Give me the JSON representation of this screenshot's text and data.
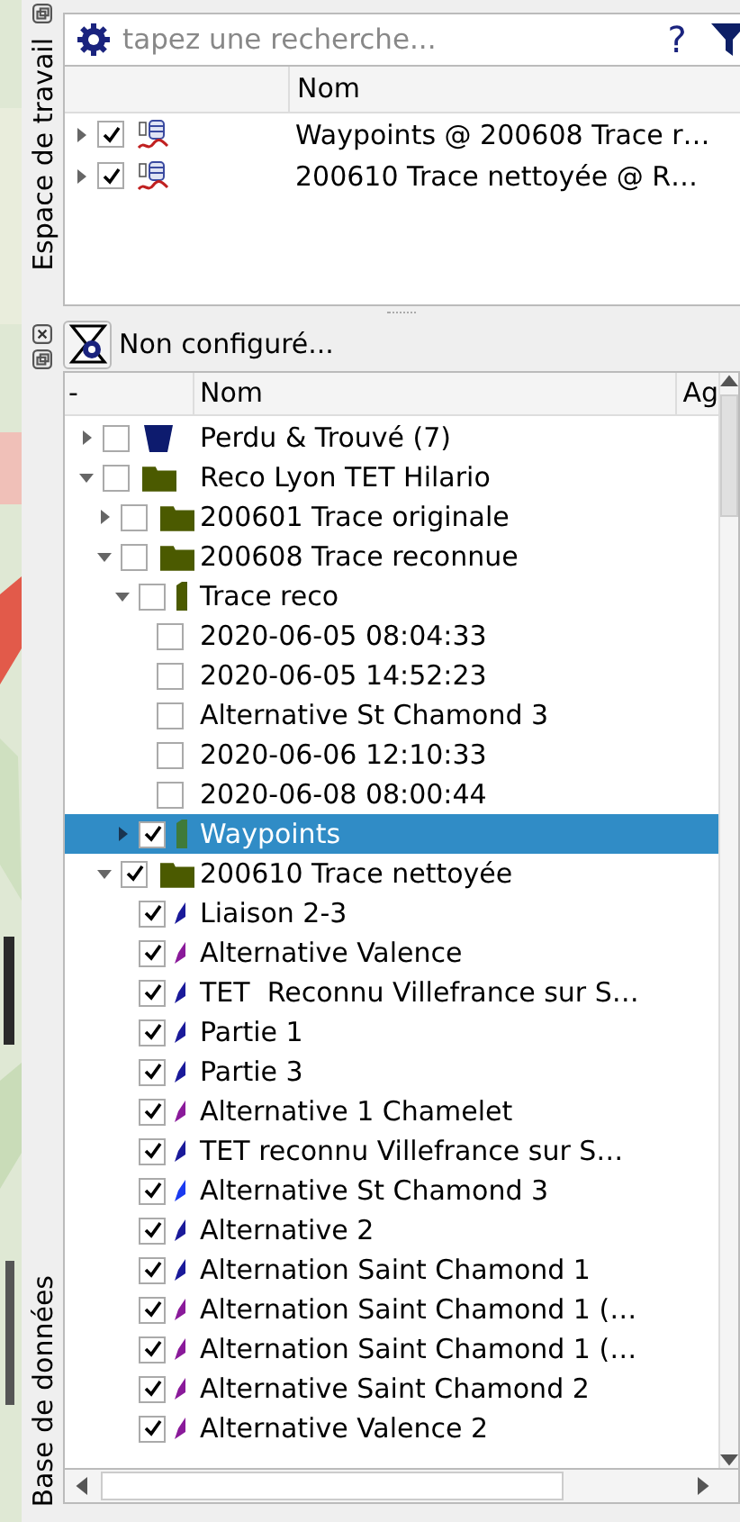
{
  "sidebar": {
    "tabs": [
      {
        "label": "Espace de travail"
      },
      {
        "label": "Base de données"
      }
    ]
  },
  "workspace": {
    "search": {
      "placeholder": "tapez une recherche..."
    },
    "help": "?",
    "columns": [
      "Nom"
    ],
    "rows": [
      {
        "label": "Waypoints @ 200608 Trace r…",
        "checked": true,
        "expanded": false
      },
      {
        "label": "200610 Trace nettoyée @ R…",
        "checked": true,
        "expanded": false
      }
    ]
  },
  "database": {
    "filter_button": "Non configuré...",
    "columns": [
      "-",
      "Nom",
      "Ag"
    ],
    "tree": [
      {
        "kind": "bin",
        "label": "Perdu & Trouvé (7)",
        "checked": false,
        "expanded": false,
        "selected": false
      },
      {
        "kind": "folder",
        "label": "Reco Lyon TET Hilario",
        "checked": false,
        "expanded": true,
        "selected": false,
        "children": [
          {
            "kind": "folder",
            "label": "200601 Trace originale",
            "checked": false,
            "expanded": false,
            "selected": false
          },
          {
            "kind": "folder",
            "label": "200608 Trace reconnue",
            "checked": false,
            "expanded": true,
            "selected": false,
            "children": [
              {
                "kind": "group",
                "label": "Trace reco",
                "checked": false,
                "expanded": true,
                "selected": false,
                "children": [
                  {
                    "label": "2020-06-05 08:04:33",
                    "checked": false,
                    "selected": false
                  },
                  {
                    "label": "2020-06-05 14:52:23",
                    "checked": false,
                    "selected": false
                  },
                  {
                    "label": "Alternative St Chamond 3",
                    "checked": false,
                    "selected": false
                  },
                  {
                    "label": "2020-06-06 12:10:33",
                    "checked": false,
                    "selected": false
                  },
                  {
                    "label": "2020-06-08 08:00:44",
                    "checked": false,
                    "selected": false
                  }
                ]
              },
              {
                "kind": "group",
                "label": "Waypoints",
                "checked": true,
                "expanded": false,
                "selected": true
              }
            ]
          },
          {
            "kind": "folder",
            "label": "200610 Trace nettoyée",
            "checked": true,
            "expanded": true,
            "selected": false,
            "children": [
              {
                "kind": "track",
                "label": "Liaison 2-3",
                "checked": true,
                "selected": false,
                "color": "#1a1a9a"
              },
              {
                "kind": "track",
                "label": "Alternative Valence",
                "checked": true,
                "selected": false,
                "color": "#8a1a9a"
              },
              {
                "kind": "track",
                "label": "TET  Reconnu Villefrance sur S…",
                "checked": true,
                "selected": false,
                "color": "#1a1a9a"
              },
              {
                "kind": "track",
                "label": "Partie 1",
                "checked": true,
                "selected": false,
                "color": "#1a1a9a"
              },
              {
                "kind": "track",
                "label": "Partie 3",
                "checked": true,
                "selected": false,
                "color": "#1a1a9a"
              },
              {
                "kind": "track",
                "label": "Alternative 1 Chamelet",
                "checked": true,
                "selected": false,
                "color": "#8a1a9a"
              },
              {
                "kind": "track",
                "label": "TET reconnu Villefrance sur S…",
                "checked": true,
                "selected": false,
                "color": "#1a1a9a"
              },
              {
                "kind": "track",
                "label": "Alternative St Chamond 3",
                "checked": true,
                "selected": false,
                "color": "#1a3af0"
              },
              {
                "kind": "track",
                "label": "Alternative 2",
                "checked": true,
                "selected": false,
                "color": "#1a1a9a"
              },
              {
                "kind": "track",
                "label": "Alternation Saint Chamond 1",
                "checked": true,
                "selected": false,
                "color": "#1a1a9a"
              },
              {
                "kind": "track",
                "label": "Alternation Saint Chamond 1 (…",
                "checked": true,
                "selected": false,
                "color": "#8a1a9a"
              },
              {
                "kind": "track",
                "label": "Alternation Saint Chamond 1 (…",
                "checked": true,
                "selected": false,
                "color": "#8a1a9a"
              },
              {
                "kind": "track",
                "label": "Alternative Saint Chamond 2",
                "checked": true,
                "selected": false,
                "color": "#8a1a9a"
              },
              {
                "kind": "track",
                "label": "Alternative Valence 2",
                "checked": true,
                "selected": false,
                "color": "#8a1a9a"
              }
            ]
          }
        ]
      }
    ]
  }
}
